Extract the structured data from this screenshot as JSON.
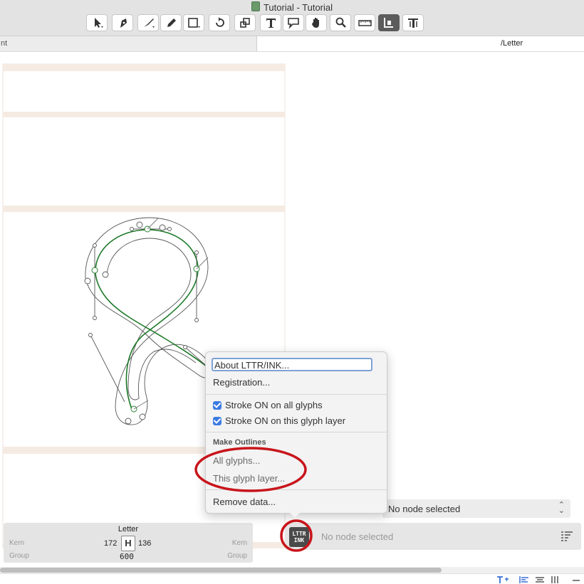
{
  "window": {
    "title": "Tutorial - Tutorial"
  },
  "toolbar": {
    "tools": [
      "select-tool",
      "pen-tool",
      "draw-tool",
      "pencil-tool",
      "primitives-tool",
      "rotate-tool",
      "scale-tool",
      "text-tool",
      "annotation-tool",
      "hand-tool",
      "zoom-tool",
      "measure-tool",
      "sidebearings-tool",
      "text-metrics-tool"
    ],
    "active_tool": "sidebearings-tool"
  },
  "tabs": {
    "left_label": "nt",
    "right_label": "/Letter"
  },
  "menu": {
    "about": "About LTTR/INK...",
    "registration": "Registration...",
    "stroke_all": "Stroke ON on all glyphs",
    "stroke_layer": "Stroke ON on this glyph layer",
    "outlines_header": "Make Outlines",
    "all_glyphs": "All glyphs...",
    "this_layer": "This glyph layer...",
    "remove_data": "Remove data..."
  },
  "node_select": {
    "value": "No node selected"
  },
  "inspector": {
    "label": "No node selected",
    "plugin_icon_text_top": "LTTR",
    "plugin_icon_text_bottom": "INK"
  },
  "metrics": {
    "glyph_name": "Letter",
    "kern_left_label": "Kern",
    "kern_right_label": "Kern",
    "group_left_label": "Group",
    "group_right_label": "Group",
    "lsb": "172",
    "rsb": "136",
    "width": "600",
    "glyph_preview": "H"
  },
  "colors": {
    "accent": "#3b7be3",
    "highlight_ring": "#c8151b",
    "stroke_path": "#1f7a2a",
    "metric_band": "#f5ebe3"
  }
}
